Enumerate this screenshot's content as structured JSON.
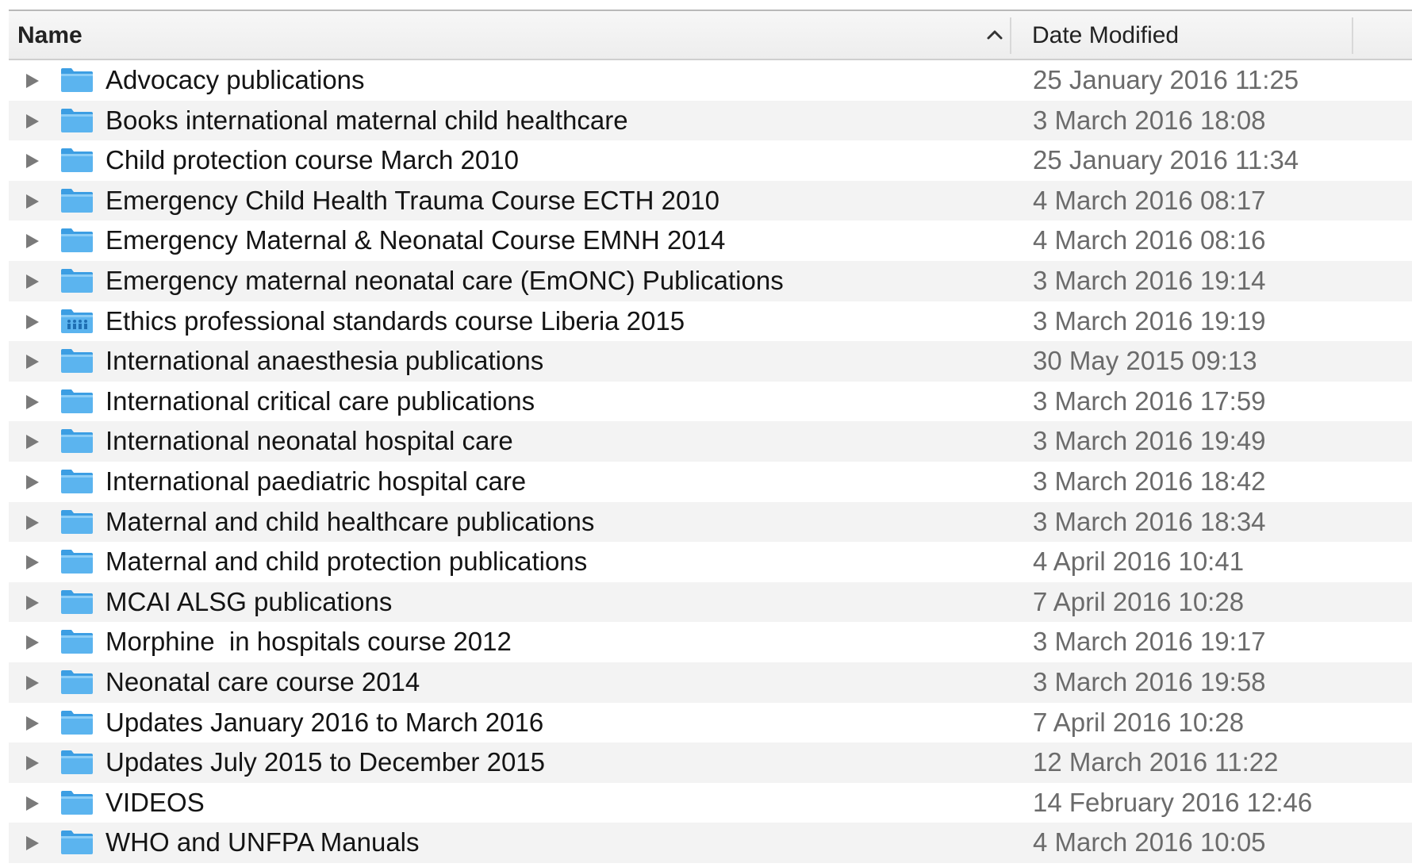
{
  "columns": {
    "name_label": "Name",
    "date_label": "Date Modified",
    "sort_icon": "chevron-up-icon"
  },
  "items": [
    {
      "name": "Advocacy publications",
      "date": "25 January 2016 11:25",
      "icon": "folder-icon"
    },
    {
      "name": "Books international maternal child healthcare",
      "date": "3 March 2016 18:08",
      "icon": "folder-icon"
    },
    {
      "name": "Child protection course March 2010",
      "date": "25 January 2016 11:34",
      "icon": "folder-icon"
    },
    {
      "name": "Emergency Child Health Trauma Course ECTH 2010",
      "date": "4 March 2016 08:17",
      "icon": "folder-icon"
    },
    {
      "name": "Emergency Maternal & Neonatal Course EMNH 2014",
      "date": "4 March 2016 08:16",
      "icon": "folder-icon"
    },
    {
      "name": "Emergency maternal neonatal care (EmONC) Publications",
      "date": "3 March 2016 19:14",
      "icon": "folder-icon"
    },
    {
      "name": "Ethics professional standards course Liberia 2015",
      "date": "3 March 2016 19:19",
      "icon": "shared-folder-icon"
    },
    {
      "name": "International anaesthesia publications",
      "date": "30 May 2015 09:13",
      "icon": "folder-icon"
    },
    {
      "name": "International critical care publications",
      "date": "3 March 2016 17:59",
      "icon": "folder-icon"
    },
    {
      "name": "International neonatal hospital care",
      "date": "3 March 2016 19:49",
      "icon": "folder-icon"
    },
    {
      "name": "International paediatric hospital care",
      "date": "3 March 2016 18:42",
      "icon": "folder-icon"
    },
    {
      "name": "Maternal and child healthcare publications",
      "date": "3 March 2016 18:34",
      "icon": "folder-icon"
    },
    {
      "name": "Maternal and child protection publications",
      "date": "4 April 2016 10:41",
      "icon": "folder-icon"
    },
    {
      "name": "MCAI ALSG publications",
      "date": "7 April 2016 10:28",
      "icon": "folder-icon"
    },
    {
      "name": "Morphine  in hospitals course 2012",
      "date": "3 March 2016 19:17",
      "icon": "folder-icon"
    },
    {
      "name": "Neonatal care course 2014",
      "date": "3 March 2016 19:58",
      "icon": "folder-icon"
    },
    {
      "name": "Updates January 2016 to March 2016",
      "date": "7 April 2016 10:28",
      "icon": "folder-icon"
    },
    {
      "name": "Updates July 2015 to December 2015",
      "date": "12 March 2016 11:22",
      "icon": "folder-icon"
    },
    {
      "name": "VIDEOS",
      "date": "14 February 2016 12:46",
      "icon": "folder-icon"
    },
    {
      "name": "WHO and UNFPA Manuals",
      "date": "4 March 2016 10:05",
      "icon": "folder-icon"
    }
  ],
  "colors": {
    "folder_blue": "#5bb4ef",
    "folder_blue_dark": "#3c9ee3",
    "alt_row": "#f3f3f3",
    "date_text": "#6b6b6b"
  }
}
